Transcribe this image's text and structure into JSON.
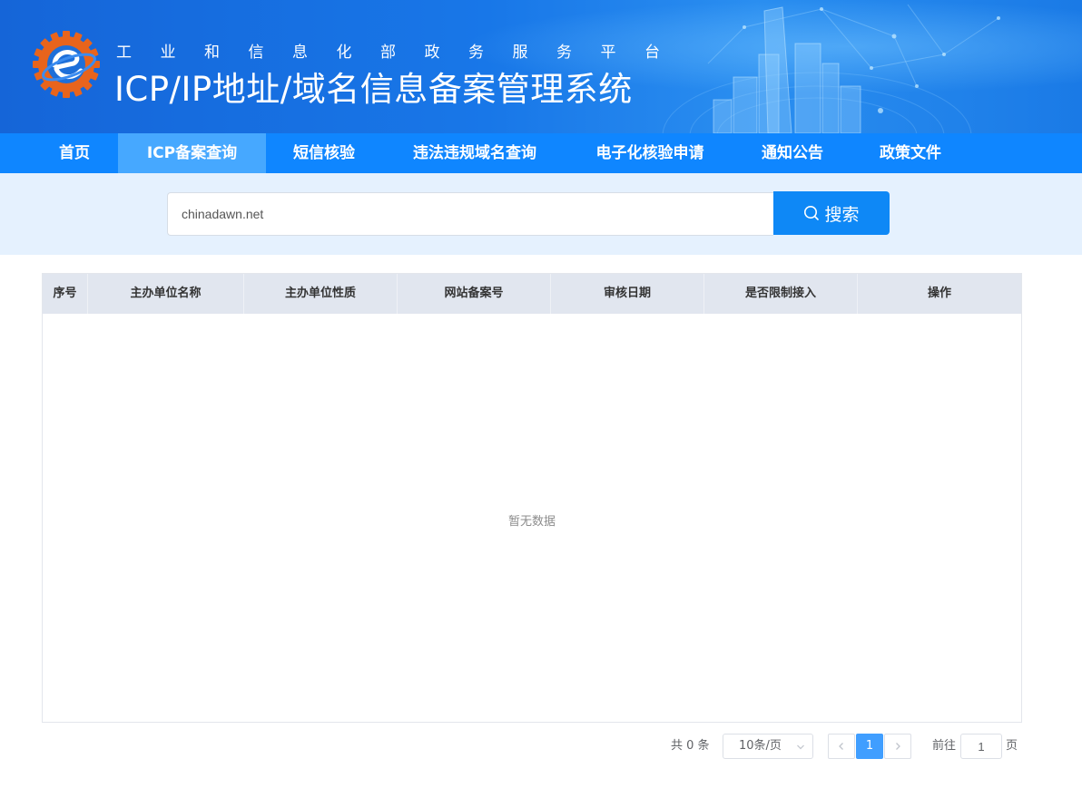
{
  "header": {
    "subtitle": "工业和信息化部政务服务平台",
    "title": "ICP/IP地址/域名信息备案管理系统"
  },
  "nav": {
    "items": [
      {
        "label": "首页"
      },
      {
        "label": "ICP备案查询",
        "active": true
      },
      {
        "label": "短信核验"
      },
      {
        "label": "违法违规域名查询"
      },
      {
        "label": "电子化核验申请"
      },
      {
        "label": "通知公告"
      },
      {
        "label": "政策文件"
      }
    ]
  },
  "search": {
    "value": "chinadawn.net",
    "button_label": "搜索"
  },
  "table": {
    "columns": [
      "序号",
      "主办单位名称",
      "主办单位性质",
      "网站备案号",
      "审核日期",
      "是否限制接入",
      "操作"
    ],
    "rows": [],
    "empty_text": "暂无数据"
  },
  "pagination": {
    "total_text": "共 0 条",
    "page_size": "10条/页",
    "current_page": "1",
    "goto_prefix": "前往",
    "goto_value": "1",
    "goto_suffix": "页"
  },
  "colors": {
    "nav_bg": "#0f86ff",
    "nav_active": "#46a8ff",
    "search_area_bg": "#e5f1fe",
    "primary": "#0e88f6",
    "page_active": "#409eff"
  }
}
